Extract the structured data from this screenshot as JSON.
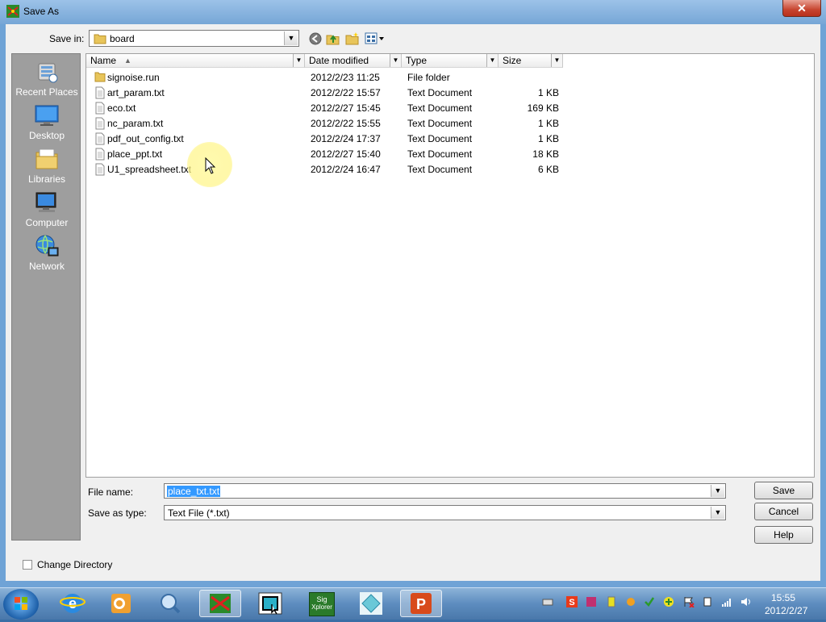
{
  "window": {
    "title": "Save As",
    "close_label": "✕"
  },
  "toolbar": {
    "save_in_label": "Save in:",
    "save_in_value": "board"
  },
  "places": [
    {
      "label": "Recent Places",
      "icon": "recent-places-icon"
    },
    {
      "label": "Desktop",
      "icon": "desktop-icon"
    },
    {
      "label": "Libraries",
      "icon": "libraries-icon"
    },
    {
      "label": "Computer",
      "icon": "computer-icon"
    },
    {
      "label": "Network",
      "icon": "network-icon"
    }
  ],
  "columns": {
    "name": "Name",
    "date": "Date modified",
    "type": "Type",
    "size": "Size"
  },
  "files": [
    {
      "name": "signoise.run",
      "date": "2012/2/23 11:25",
      "type": "File folder",
      "size": "",
      "kind": "folder"
    },
    {
      "name": "art_param.txt",
      "date": "2012/2/22 15:57",
      "type": "Text Document",
      "size": "1 KB",
      "kind": "text"
    },
    {
      "name": "eco.txt",
      "date": "2012/2/27 15:45",
      "type": "Text Document",
      "size": "169 KB",
      "kind": "text"
    },
    {
      "name": "nc_param.txt",
      "date": "2012/2/22 15:55",
      "type": "Text Document",
      "size": "1 KB",
      "kind": "text"
    },
    {
      "name": "pdf_out_config.txt",
      "date": "2012/2/24 17:37",
      "type": "Text Document",
      "size": "1 KB",
      "kind": "text"
    },
    {
      "name": "place_ppt.txt",
      "date": "2012/2/27 15:40",
      "type": "Text Document",
      "size": "18 KB",
      "kind": "text"
    },
    {
      "name": "U1_spreadsheet.txt",
      "date": "2012/2/24 16:47",
      "type": "Text Document",
      "size": "6 KB",
      "kind": "text"
    }
  ],
  "form": {
    "file_name_label": "File name:",
    "file_name_value": "place_txt.txt",
    "save_type_label": "Save as type:",
    "save_type_value": "Text File (*.txt)",
    "change_dir_label": "Change Directory"
  },
  "buttons": {
    "save": "Save",
    "cancel": "Cancel",
    "help": "Help"
  },
  "taskbar": {
    "apps": [
      "internet-explorer",
      "outlook",
      "search-tool",
      "allegro-pcb",
      "pcb-editor",
      "sigxplorer",
      "diamond-app",
      "powerpoint"
    ],
    "sig_label_1": "Sig",
    "sig_label_2": "Xplorer",
    "clock_time": "15:55",
    "clock_date": "2012/2/27"
  }
}
